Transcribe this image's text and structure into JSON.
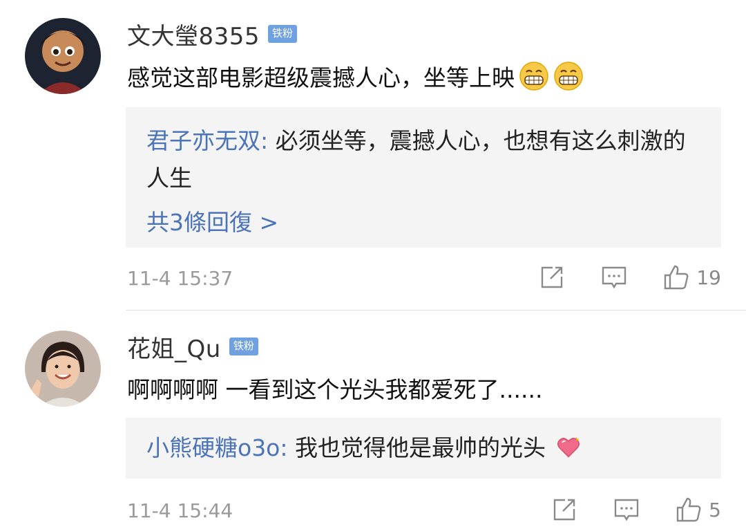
{
  "comments": [
    {
      "username": "文大瑩8355",
      "badge": "铁粉",
      "content": "感觉这部电影超级震撼人心，坐等上映",
      "emoji": [
        "grin-emoji",
        "grin-emoji"
      ],
      "reply": {
        "user": "君子亦无双",
        "separator": ": ",
        "text": "必须坐等，震撼人心，也想有这么刺激的人生"
      },
      "reply_count": "共3條回復 >",
      "timestamp": "11-4 15:37",
      "likes": "19"
    },
    {
      "username": "花姐_Qu",
      "badge": "铁粉",
      "content": "啊啊啊啊 一看到这个光头我都爱死了......",
      "reply": {
        "user": "小熊硬糖o3o",
        "separator": ": ",
        "text": "我也觉得他是最帅的光头"
      },
      "timestamp": "11-4 15:44",
      "likes": "5"
    }
  ],
  "colors": {
    "link_blue": "#4a73b8",
    "badge_blue": "#6fa0e0",
    "reply_bg": "#f4f4f4",
    "meta_gray": "#9a9a9a"
  }
}
